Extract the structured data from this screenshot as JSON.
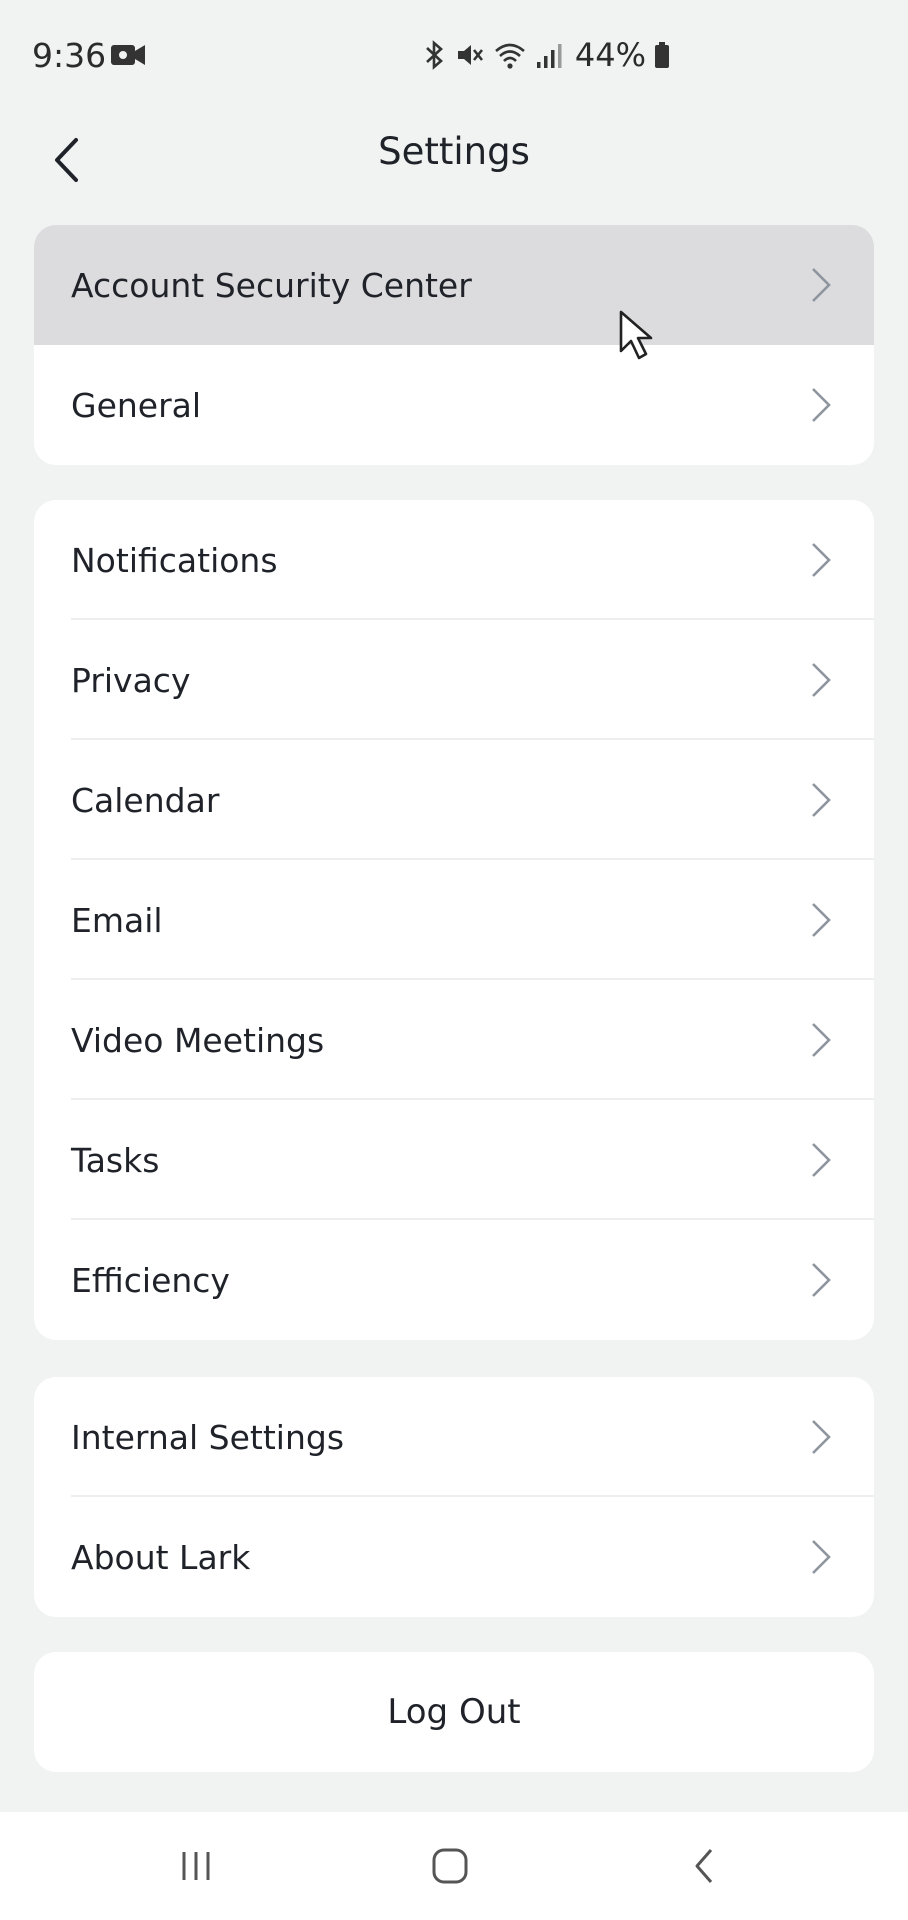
{
  "status_bar": {
    "time": "9:36",
    "battery_percent": "44%",
    "icons": [
      "camera-icon",
      "bluetooth-icon",
      "mute-icon",
      "wifi-icon",
      "signal-icon",
      "battery-icon"
    ]
  },
  "header": {
    "title": "Settings",
    "back_icon": "chevron-left-icon"
  },
  "groups": [
    {
      "items": [
        {
          "label": "Account Security Center",
          "state": "pressed"
        },
        {
          "label": "General"
        }
      ]
    },
    {
      "items": [
        {
          "label": "Notifications"
        },
        {
          "label": "Privacy"
        },
        {
          "label": "Calendar"
        },
        {
          "label": "Email"
        },
        {
          "label": "Video Meetings"
        },
        {
          "label": "Tasks"
        },
        {
          "label": "Efficiency"
        }
      ]
    },
    {
      "items": [
        {
          "label": "Internal Settings"
        },
        {
          "label": "About Lark"
        }
      ]
    }
  ],
  "logout_label": "Log Out",
  "nav_bar": {
    "buttons": [
      "recent-apps-icon",
      "home-icon",
      "back-icon"
    ]
  },
  "colors": {
    "background": "#f0f3f2",
    "card": "#ffffff",
    "pressed_row": "#dcdcde",
    "text": "#1f2329",
    "chevron": "#8f959e"
  }
}
